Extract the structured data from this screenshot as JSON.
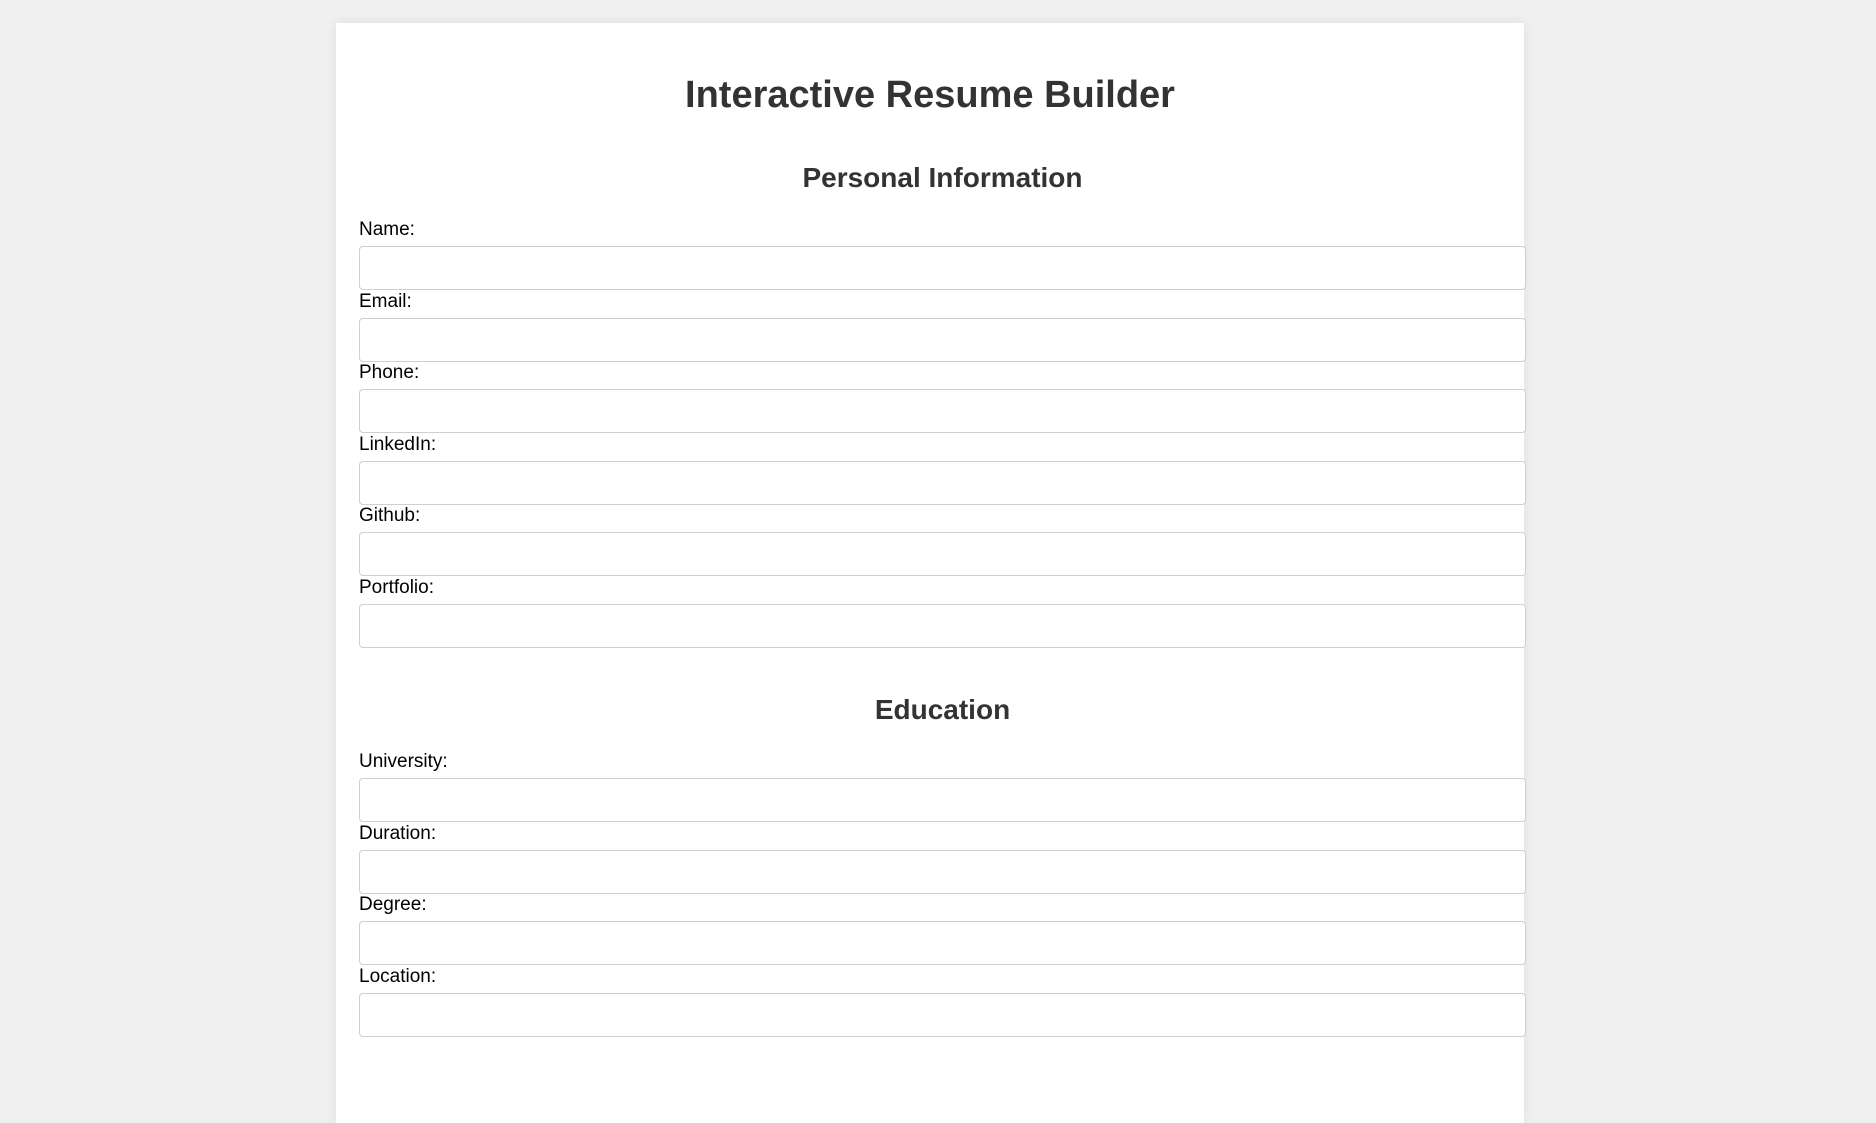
{
  "page": {
    "title": "Interactive Resume Builder"
  },
  "personal": {
    "title": "Personal Information",
    "fields": [
      {
        "label": "Name:",
        "value": "",
        "placeholder": ""
      },
      {
        "label": "Email:",
        "value": "",
        "placeholder": ""
      },
      {
        "label": "Phone:",
        "value": "",
        "placeholder": ""
      },
      {
        "label": "LinkedIn:",
        "value": "",
        "placeholder": ""
      },
      {
        "label": "Github:",
        "value": "",
        "placeholder": ""
      },
      {
        "label": "Portfolio:",
        "value": "",
        "placeholder": ""
      }
    ]
  },
  "education": {
    "title": "Education",
    "fields": [
      {
        "label": "University:",
        "value": "",
        "placeholder": ""
      },
      {
        "label": "Duration:",
        "value": "",
        "placeholder": ""
      },
      {
        "label": "Degree:",
        "value": "",
        "placeholder": ""
      },
      {
        "label": "Location:",
        "value": "",
        "placeholder": ""
      }
    ]
  },
  "colors": {
    "background": "#f0f0f0",
    "panel": "#ffffff",
    "heading": "#333333",
    "label": "#000000",
    "input_border": "#cfcfcf"
  }
}
